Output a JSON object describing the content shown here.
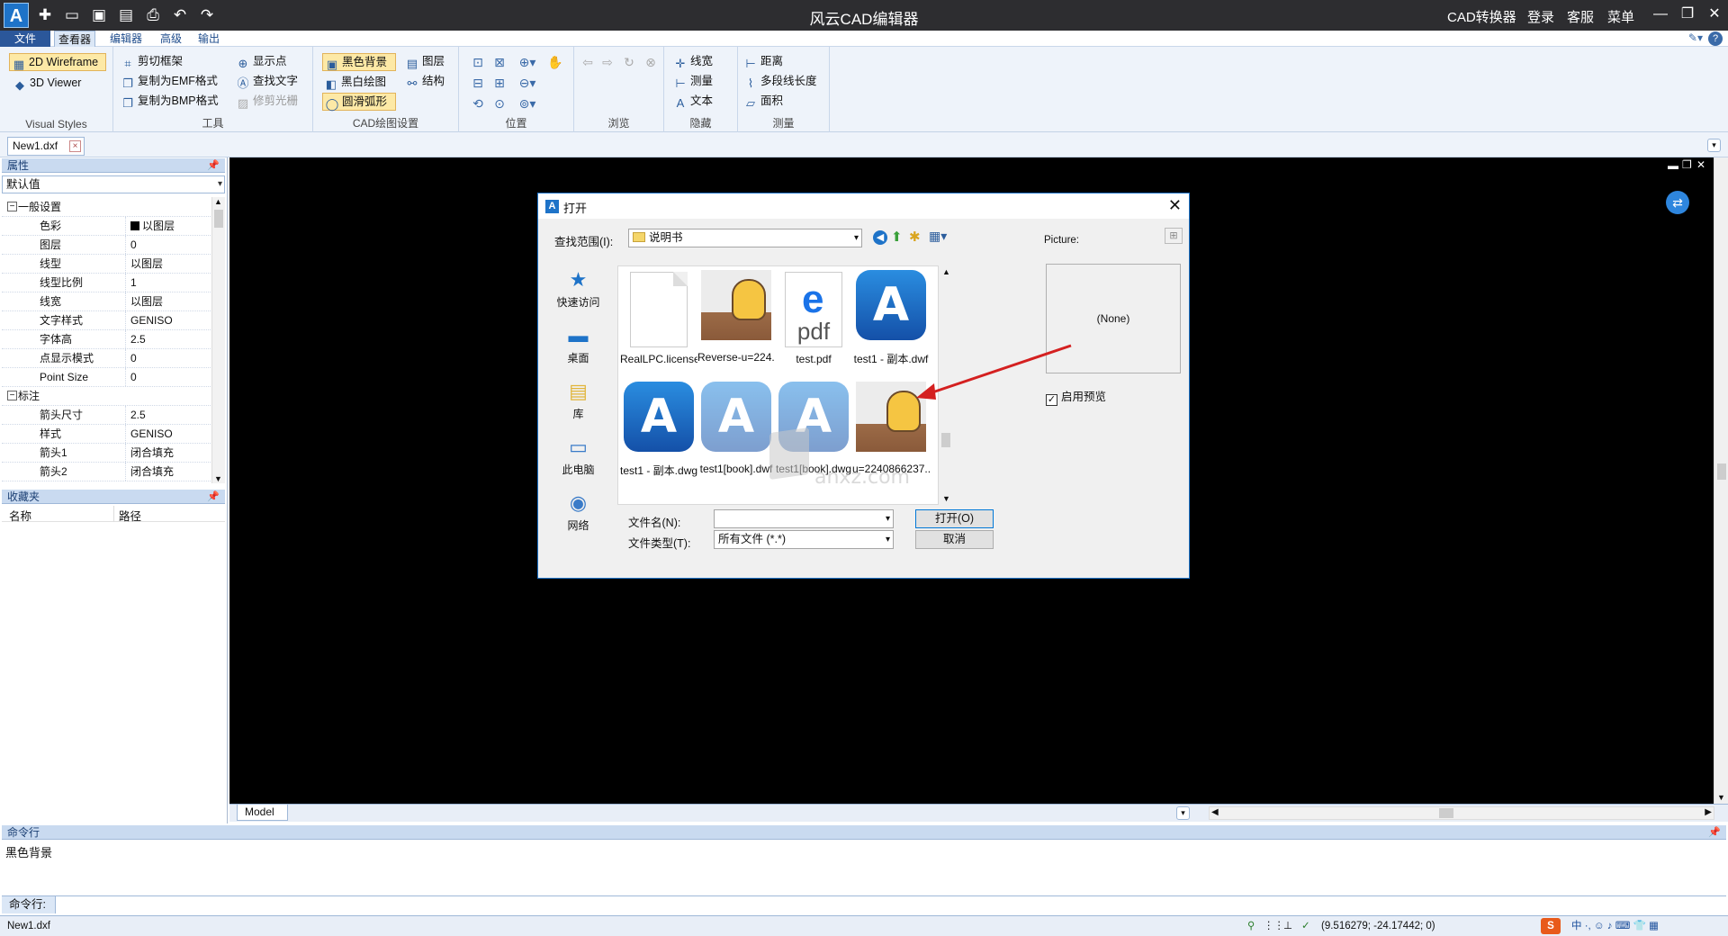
{
  "titlebar": {
    "title": "风云CAD编辑器",
    "links": [
      "CAD转换器",
      "登录",
      "客服",
      "菜单"
    ],
    "quick_access_icons": [
      "new-file-icon",
      "open-folder-icon",
      "save-icon",
      "save-as-icon",
      "print-icon",
      "undo-icon",
      "redo-icon"
    ]
  },
  "menu_tabs": [
    {
      "label": "文件",
      "type": "file"
    },
    {
      "label": "查看器",
      "active": true
    },
    {
      "label": "编辑器"
    },
    {
      "label": "高级"
    },
    {
      "label": "输出"
    }
  ],
  "ribbon": {
    "visual_styles": {
      "items": [
        "2D Wireframe",
        "3D Viewer"
      ],
      "label": "Visual Styles"
    },
    "tools": {
      "items": [
        "剪切框架",
        "复制为EMF格式",
        "复制为BMP格式",
        "显示点",
        "查找文字",
        "修剪光栅"
      ],
      "label": "工具"
    },
    "cad_settings": {
      "items": [
        "黑色背景",
        "黑白绘图",
        "圆滑弧形",
        "图层",
        "结构"
      ],
      "label": "CAD绘图设置"
    },
    "position": {
      "label": "位置"
    },
    "browse": {
      "label": "浏览"
    },
    "hide": {
      "items": [
        "线宽",
        "测量",
        "文本"
      ],
      "label": "隐藏"
    },
    "measure": {
      "items": [
        "距离",
        "多段线长度",
        "面积"
      ],
      "label": "测量"
    }
  },
  "doc_tab": {
    "label": "New1.dxf"
  },
  "properties": {
    "title": "属性",
    "combo": "默认值",
    "cat1": "一般设置",
    "rows1": [
      {
        "k": "色彩",
        "v": "以图层",
        "swatch": true
      },
      {
        "k": "图层",
        "v": "0"
      },
      {
        "k": "线型",
        "v": "以图层"
      },
      {
        "k": "线型比例",
        "v": "1"
      },
      {
        "k": "线宽",
        "v": "以图层"
      },
      {
        "k": "文字样式",
        "v": "GENISO"
      },
      {
        "k": "字体高",
        "v": "2.5"
      },
      {
        "k": "点显示模式",
        "v": "0"
      },
      {
        "k": "Point Size",
        "v": "0"
      }
    ],
    "cat2": "标注",
    "rows2": [
      {
        "k": "箭头尺寸",
        "v": "2.5"
      },
      {
        "k": "样式",
        "v": "GENISO"
      },
      {
        "k": "箭头1",
        "v": "闭合填充"
      },
      {
        "k": "箭头2",
        "v": "闭合填充"
      }
    ]
  },
  "favorites": {
    "title": "收藏夹",
    "col_name": "名称",
    "col_path": "路径"
  },
  "model_tab": "Model",
  "command": {
    "title": "命令行",
    "output": "黑色背景",
    "input_label": "命令行:"
  },
  "status": {
    "file": "New1.dxf",
    "coords": "(9.516279; -24.17442; 0)"
  },
  "dialog": {
    "title": "打开",
    "lookin_label": "查找范围(I):",
    "lookin_value": "说明书",
    "places": [
      "快速访问",
      "桌面",
      "库",
      "此电脑",
      "网络"
    ],
    "files": [
      {
        "name": "RealLPC.license",
        "kind": "blank"
      },
      {
        "name": "Reverse-u=224...",
        "kind": "cat"
      },
      {
        "name": "test.pdf",
        "kind": "pdf"
      },
      {
        "name": "test1 - 副本.dwf",
        "kind": "cad"
      },
      {
        "name": "test1 - 副本.dwg",
        "kind": "cad"
      },
      {
        "name": "test1[book].dwf",
        "kind": "cad"
      },
      {
        "name": "test1[book].dwg",
        "kind": "cad"
      },
      {
        "name": "u=2240866237...",
        "kind": "cat"
      }
    ],
    "filename_label": "文件名(N):",
    "filename_value": "",
    "filetype_label": "文件类型(T):",
    "filetype_value": "所有文件 (*.*)",
    "open_button": "打开(O)",
    "cancel_button": "取消",
    "picture_label": "Picture:",
    "preview_text": "(None)",
    "enable_preview": "启用预览"
  },
  "watermark": "anxz.com"
}
